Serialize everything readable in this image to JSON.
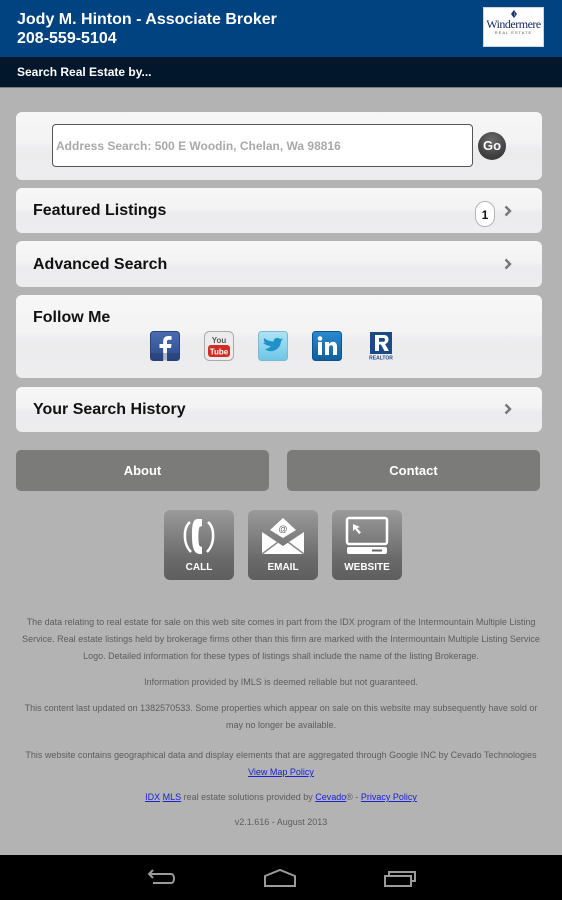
{
  "header": {
    "agent_name": "Jody M. Hinton - Associate Broker",
    "phone": "208-559-5104",
    "logo": {
      "word": "Windermere",
      "sub": "REAL ESTATE",
      "icon": "windermere-logo-icon"
    }
  },
  "subbar": {
    "title": "Search Real Estate by..."
  },
  "search": {
    "placeholder": "Address Search: 500 E Woodin, Chelan, Wa 98816",
    "value": "",
    "go_label": "Go"
  },
  "menu": {
    "featured": {
      "label": "Featured Listings",
      "badge": "1",
      "icon": "chevron-right-icon"
    },
    "advanced": {
      "label": "Advanced Search",
      "icon": "chevron-right-icon"
    },
    "follow": {
      "label": "Follow Me",
      "social": [
        {
          "name": "Facebook",
          "icon": "facebook-icon",
          "color": "#3b5998"
        },
        {
          "name": "YouTube",
          "icon": "youtube-icon",
          "color": "#d32a25",
          "text_top": "You",
          "text_bottom": "Tube"
        },
        {
          "name": "Twitter",
          "icon": "twitter-icon",
          "color": "#5ec3e8"
        },
        {
          "name": "LinkedIn",
          "icon": "linkedin-icon",
          "color": "#1a75bb"
        },
        {
          "name": "Realtor",
          "icon": "realtor-icon",
          "color": "#1c4a86",
          "text": "REALTOR"
        }
      ]
    },
    "history": {
      "label": "Your Search History",
      "icon": "chevron-right-icon"
    }
  },
  "buttons": {
    "about": "About",
    "contact": "Contact"
  },
  "contact_icons": [
    {
      "label": "CALL",
      "icon": "phone-icon"
    },
    {
      "label": "EMAIL",
      "icon": "envelope-icon"
    },
    {
      "label": "WEBSITE",
      "icon": "computer-icon"
    }
  ],
  "footer": {
    "disclaimer": "The data relating to real estate for sale on this web site comes in part from the IDX program of the Intermountain Multiple Listing Service. Real estate listings held by brokerage firms other than this firm are marked with the Intermountain Multiple Listing Service Logo. Detailed information for these types of listings shall include the name of the listing Brokerage.",
    "reliability": "Information provided by IMLS is deemed reliable but not guaranteed.",
    "updated": "This content last updated on 1382570533. Some properties which appear on sale on this website may subsequently have sold or may no longer be available.",
    "geo_text": "This website contains geographical data and display elements that are aggregated through Google INC by Cevado Technologies ",
    "geo_link": "View Map Policy",
    "idx_link": "IDX",
    "mls_link": "MLS",
    "solutions_text": " real estate solutions provided by ",
    "cevado_link": "Cevado",
    "registered": "® - ",
    "privacy_link": "Privacy Policy",
    "version": "v2.1.616 - August 2013"
  },
  "navbar": {
    "back": "back-icon",
    "home": "home-icon",
    "recent": "recent-apps-icon"
  },
  "colors": {
    "header_bg": "#004380",
    "subbar_bg": "#02172b",
    "page_bg": "#b3b3b3",
    "button_bg": "#7b7c7a",
    "link": "#1a22d6"
  }
}
